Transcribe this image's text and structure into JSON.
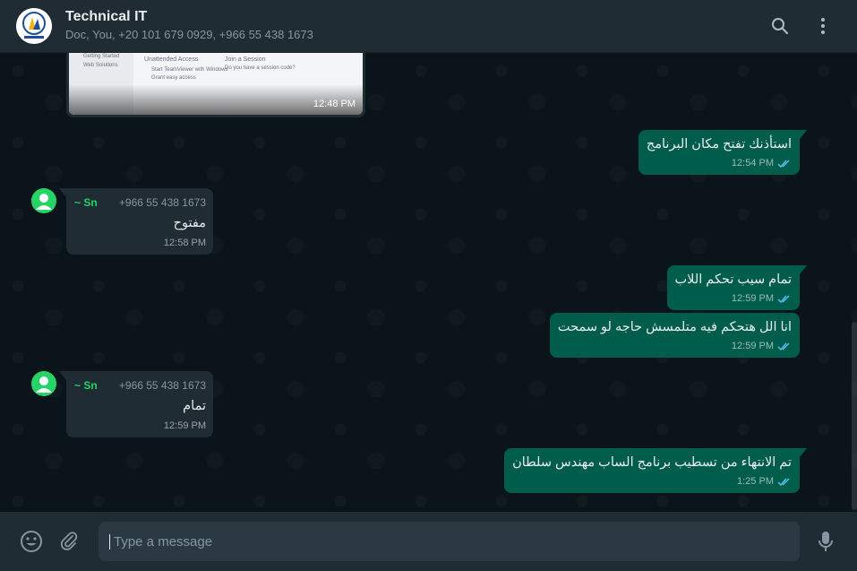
{
  "header": {
    "title": "Technical IT",
    "participants": "Doc, You, +20 101 679 0929, +966 55 438 1673",
    "icons": [
      "search-icon",
      "menu-dots-icon"
    ]
  },
  "screenshot_msg": {
    "time": "12:48 PM",
    "heading_left": "Unattended Access",
    "heading_right": "Join a Session",
    "line1": "Start TeamViewer with Windows",
    "line2": "Grant easy access",
    "line3": "Do you have a session code?",
    "side1": "Getting Started",
    "side2": "Web Solutions"
  },
  "messages": {
    "m1": {
      "text": "استأذنك تفتح مكان البرنامج",
      "time": "12:54 PM"
    },
    "m2": {
      "name": "~ Sn",
      "phone": "+966 55 438 1673",
      "text": "مفتوح",
      "time": "12:58 PM"
    },
    "m3": {
      "text": "تمام سيب تحكم اللاب",
      "time": "12:59 PM"
    },
    "m4": {
      "text": "انا الل هتحكم فيه متلمسش حاجه لو سمحت",
      "time": "12:59 PM"
    },
    "m5": {
      "name": "~ Sn",
      "phone": "+966 55 438 1673",
      "text": "تمام",
      "time": "12:59 PM"
    },
    "m6": {
      "text": "تم الانتهاء من تسطيب برنامج الساب مهندس سلطان",
      "time": "1:25 PM"
    }
  },
  "footer": {
    "placeholder": "Type a message",
    "icons": [
      "emoji-icon",
      "attach-icon",
      "mic-icon"
    ]
  },
  "colors": {
    "outgoing": "#005c4b",
    "incoming": "#202c33",
    "header": "#202c33",
    "background": "#0b141a",
    "ticks": "#53bdeb",
    "sender": "#25d366"
  }
}
